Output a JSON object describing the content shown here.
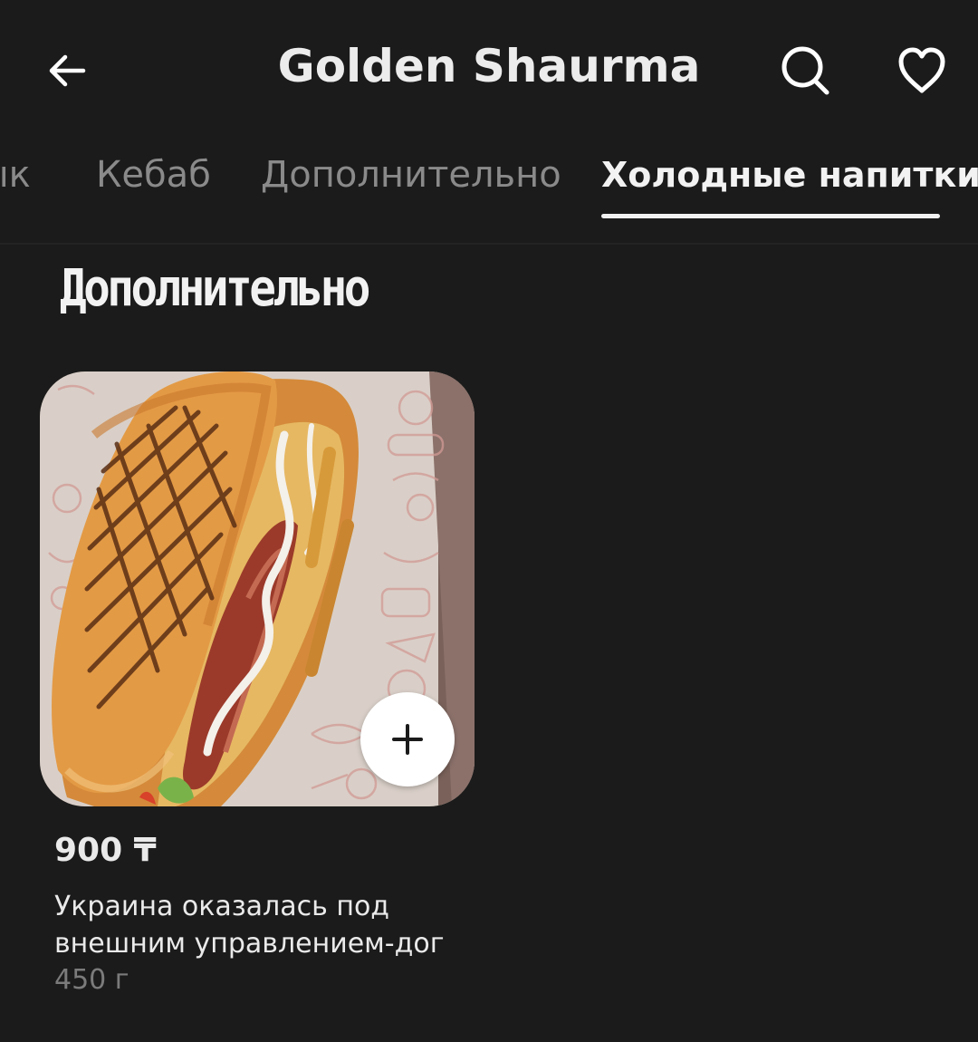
{
  "header": {
    "title": "Golden Shaurma",
    "back_icon": "arrow-left-icon",
    "search_icon": "search-icon",
    "favorite_icon": "heart-icon"
  },
  "tabs": [
    {
      "label": "ык",
      "active": false
    },
    {
      "label": "Кебаб",
      "active": false
    },
    {
      "label": "Дополнительно",
      "active": false
    },
    {
      "label": "Холодные напитки",
      "active": true
    }
  ],
  "section": {
    "title": "Дополнительно"
  },
  "products": [
    {
      "price": "900 ₸",
      "name": "Украина оказалась под внешним управлением-дог",
      "weight": "450 г",
      "add_icon": "plus-icon"
    }
  ],
  "colors": {
    "background": "#1b1b1b",
    "text_primary": "#f2f2f2",
    "text_secondary": "#8a8a8a",
    "add_button": "#ffffff"
  }
}
